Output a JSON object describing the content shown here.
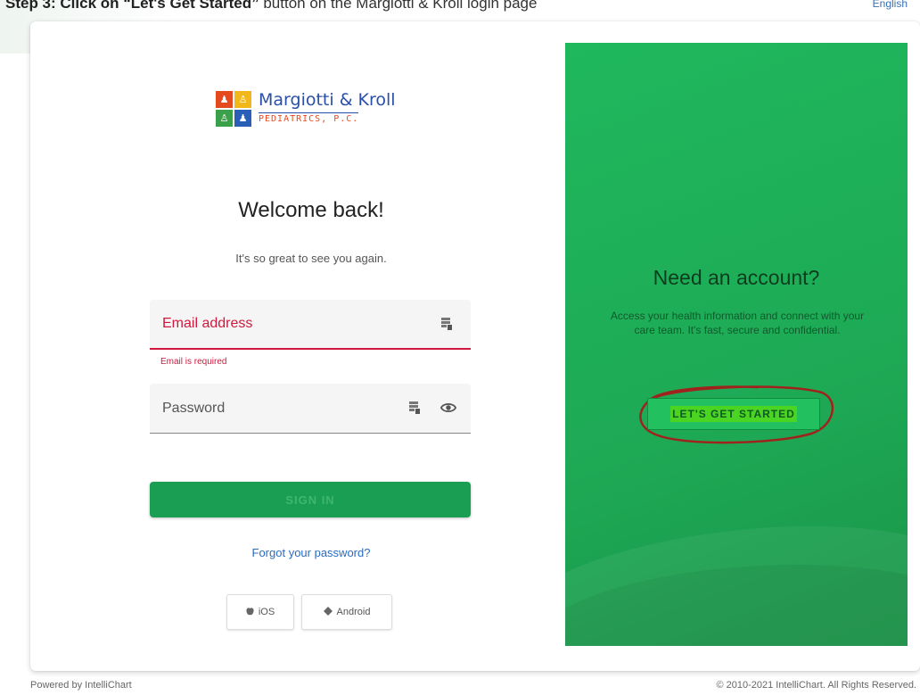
{
  "top_banner": {
    "bold_text": "Step 3: Click on “Let's Get Started”",
    "rest_text": " button on the Margiotti & Kroll login page",
    "language_link": "English"
  },
  "logo": {
    "name": "Margiotti & Kroll",
    "subtitle": "PEDIATRICS, P.C.",
    "brand_colors": [
      "#e54a1e",
      "#f2b81b",
      "#3aa04a",
      "#2a5fb8"
    ]
  },
  "login": {
    "heading": "Welcome back!",
    "subheading": "It's so great to see you again.",
    "email_placeholder": "Email address",
    "email_error": "Email is required",
    "password_placeholder": "Password",
    "sign_in_label": "SIGN IN",
    "forgot_password": "Forgot your password?",
    "ios_label": "iOS",
    "android_label": "Android"
  },
  "signup_panel": {
    "heading": "Need an account?",
    "description": "Access your health information and connect with your care team. It's fast, secure and confidential.",
    "cta_label": "LET'S GET STARTED",
    "accent_color": "#1fb85d"
  },
  "footer": {
    "powered_by": "Powered by IntelliChart",
    "copyright": "© 2010-2021 IntelliChart. All Rights Reserved."
  },
  "icons": {
    "field_icon": "password-manager-icon",
    "reveal_icon": "eye-icon",
    "ios_icon": "apple-icon",
    "android_icon": "android-icon"
  }
}
